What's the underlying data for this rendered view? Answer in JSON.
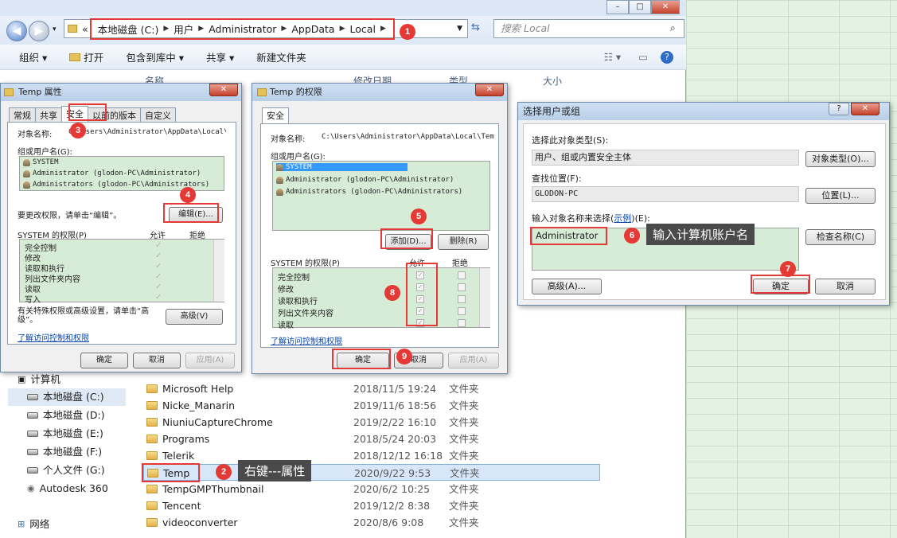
{
  "address": {
    "crumbs": [
      "本地磁盘 (C:)",
      "用户",
      "Administrator",
      "AppData",
      "Local"
    ],
    "prefix": "«",
    "search_placeholder": "搜索 Local"
  },
  "toolbar": {
    "organize": "组织 ▾",
    "open": "打开",
    "include": "包含到库中 ▾",
    "share": "共享 ▾",
    "newfolder": "新建文件夹"
  },
  "columns": {
    "name": "名称",
    "date": "修改日期",
    "type": "类型",
    "size": "大小"
  },
  "nav": {
    "computer": "计算机",
    "drives": [
      "本地磁盘 (C:)",
      "本地磁盘 (D:)",
      "本地磁盘 (E:)",
      "本地磁盘 (F:)",
      "个人文件 (G:)",
      "Autodesk 360"
    ],
    "network": "网络"
  },
  "files": [
    {
      "name": "Microsoft Help",
      "date": "2018/11/5 19:24",
      "type": "文件夹"
    },
    {
      "name": "Nicke_Manarin",
      "date": "2019/11/6 18:56",
      "type": "文件夹"
    },
    {
      "name": "NiuniuCaptureChrome",
      "date": "2019/2/22 16:10",
      "type": "文件夹"
    },
    {
      "name": "Programs",
      "date": "2018/5/24 20:03",
      "type": "文件夹"
    },
    {
      "name": "Telerik",
      "date": "2018/12/12 16:18",
      "type": "文件夹"
    },
    {
      "name": "Temp",
      "date": "2020/9/22 9:53",
      "type": "文件夹"
    },
    {
      "name": "TempGMPThumbnail",
      "date": "2020/6/2 10:25",
      "type": "文件夹"
    },
    {
      "name": "Tencent",
      "date": "2019/12/2 8:38",
      "type": "文件夹"
    },
    {
      "name": "videoconverter",
      "date": "2020/8/6 9:08",
      "type": "文件夹"
    }
  ],
  "props": {
    "title": "Temp 属性",
    "tabs": [
      "常规",
      "共享",
      "安全",
      "以前的版本",
      "自定义"
    ],
    "object_label": "对象名称:",
    "object_value": "C:\\Users\\Administrator\\AppData\\Local\\Tem",
    "group_label": "组或用户名(G):",
    "users": [
      "SYSTEM",
      "Administrator (glodon-PC\\Administrator)",
      "Administrators (glodon-PC\\Administrators)"
    ],
    "change_hint": "要更改权限，请单击“编辑”。",
    "edit_btn": "编辑(E)...",
    "perm_label": "SYSTEM 的权限(P)",
    "allow": "允许",
    "deny": "拒绝",
    "perms": [
      "完全控制",
      "修改",
      "读取和执行",
      "列出文件夹内容",
      "读取",
      "写入"
    ],
    "special_hint": "有关特殊权限或高级设置，请单击“高级”。",
    "advanced_btn": "高级(V)",
    "learn_link": "了解访问控制和权限",
    "ok": "确定",
    "cancel": "取消",
    "apply": "应用(A)"
  },
  "perm": {
    "title": "Temp 的权限",
    "tab": "安全",
    "object_label": "对象名称:",
    "object_value": "C:\\Users\\Administrator\\AppData\\Local\\Tem",
    "group_label": "组或用户名(G):",
    "users": [
      "SYSTEM",
      "Administrator (glodon-PC\\Administrator)",
      "Administrators (glodon-PC\\Administrators)"
    ],
    "add_btn": "添加(D)...",
    "remove_btn": "删除(R)",
    "perm_label": "SYSTEM 的权限(P)",
    "allow": "允许",
    "deny": "拒绝",
    "perms": [
      "完全控制",
      "修改",
      "读取和执行",
      "列出文件夹内容",
      "读取"
    ],
    "learn_link": "了解访问控制和权限",
    "ok": "确定",
    "cancel": "取消",
    "apply": "应用(A)"
  },
  "select": {
    "title": "选择用户或组",
    "type_label": "选择此对象类型(S):",
    "type_value": "用户、组或内置安全主体",
    "type_btn": "对象类型(O)...",
    "loc_label": "查找位置(F):",
    "loc_value": "GLODON-PC",
    "loc_btn": "位置(L)...",
    "name_label_pre": "输入对象名称来选择(",
    "name_label_link": "示例",
    "name_label_post": ")(E):",
    "name_value": "Administrator",
    "check_btn": "检查名称(C)",
    "advanced_btn": "高级(A)...",
    "ok": "确定",
    "cancel": "取消"
  },
  "annotations": {
    "b1": "1",
    "b2": "2",
    "b3": "3",
    "b4": "4",
    "b5": "5",
    "b6": "6",
    "b7": "7",
    "b8": "8",
    "b9": "9",
    "tip2": "右键---属性",
    "tip6": "输入计算机账户名"
  }
}
